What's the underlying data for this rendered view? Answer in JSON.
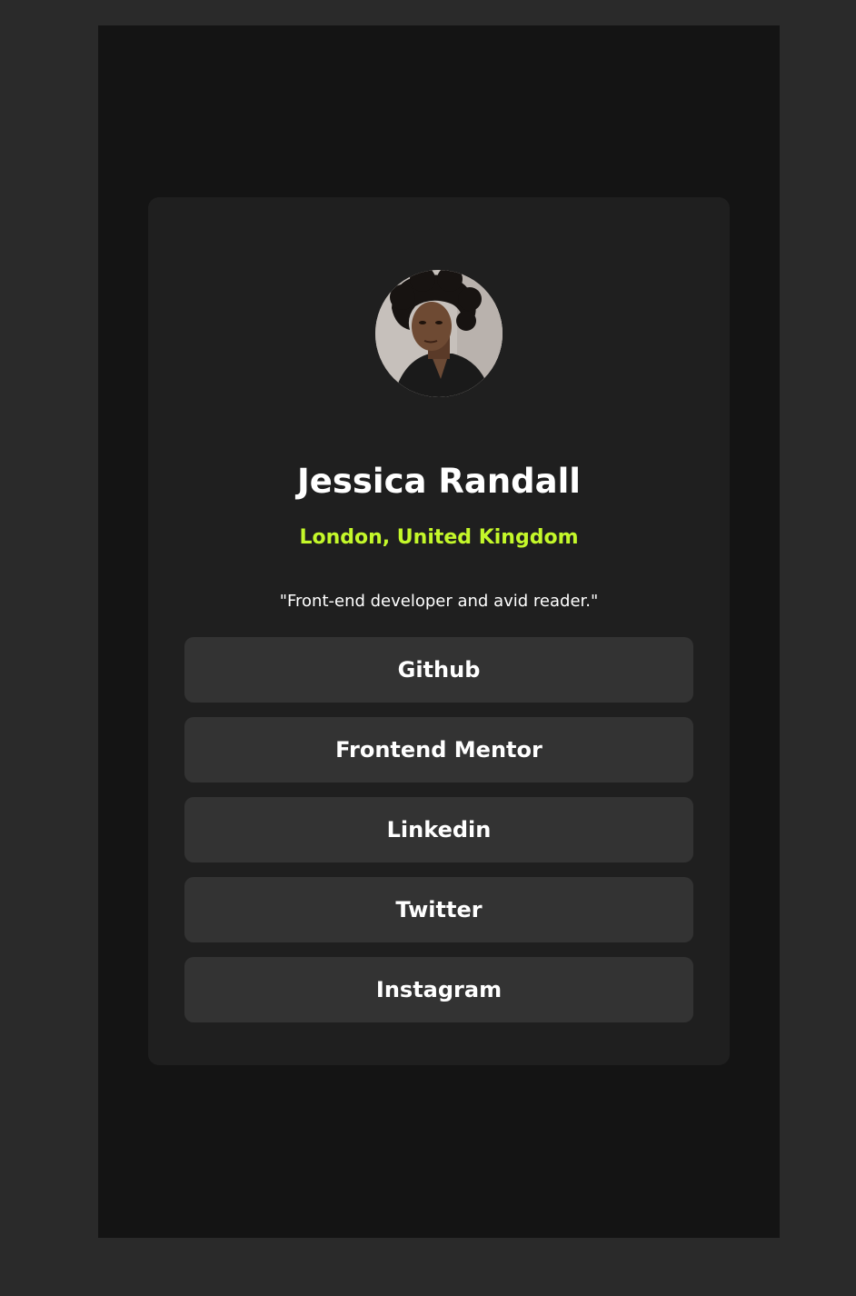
{
  "profile": {
    "name": "Jessica Randall",
    "location": "London, United Kingdom",
    "bio": "\"Front-end developer and avid reader.\""
  },
  "links": [
    {
      "label": "Github"
    },
    {
      "label": "Frontend Mentor"
    },
    {
      "label": "Linkedin"
    },
    {
      "label": "Twitter"
    },
    {
      "label": "Instagram"
    }
  ],
  "colors": {
    "page_background": "#2a2a2a",
    "frame_background": "#141414",
    "card_background": "#1f1f1f",
    "button_background": "#333333",
    "accent": "#c4f82a",
    "text": "#ffffff"
  }
}
